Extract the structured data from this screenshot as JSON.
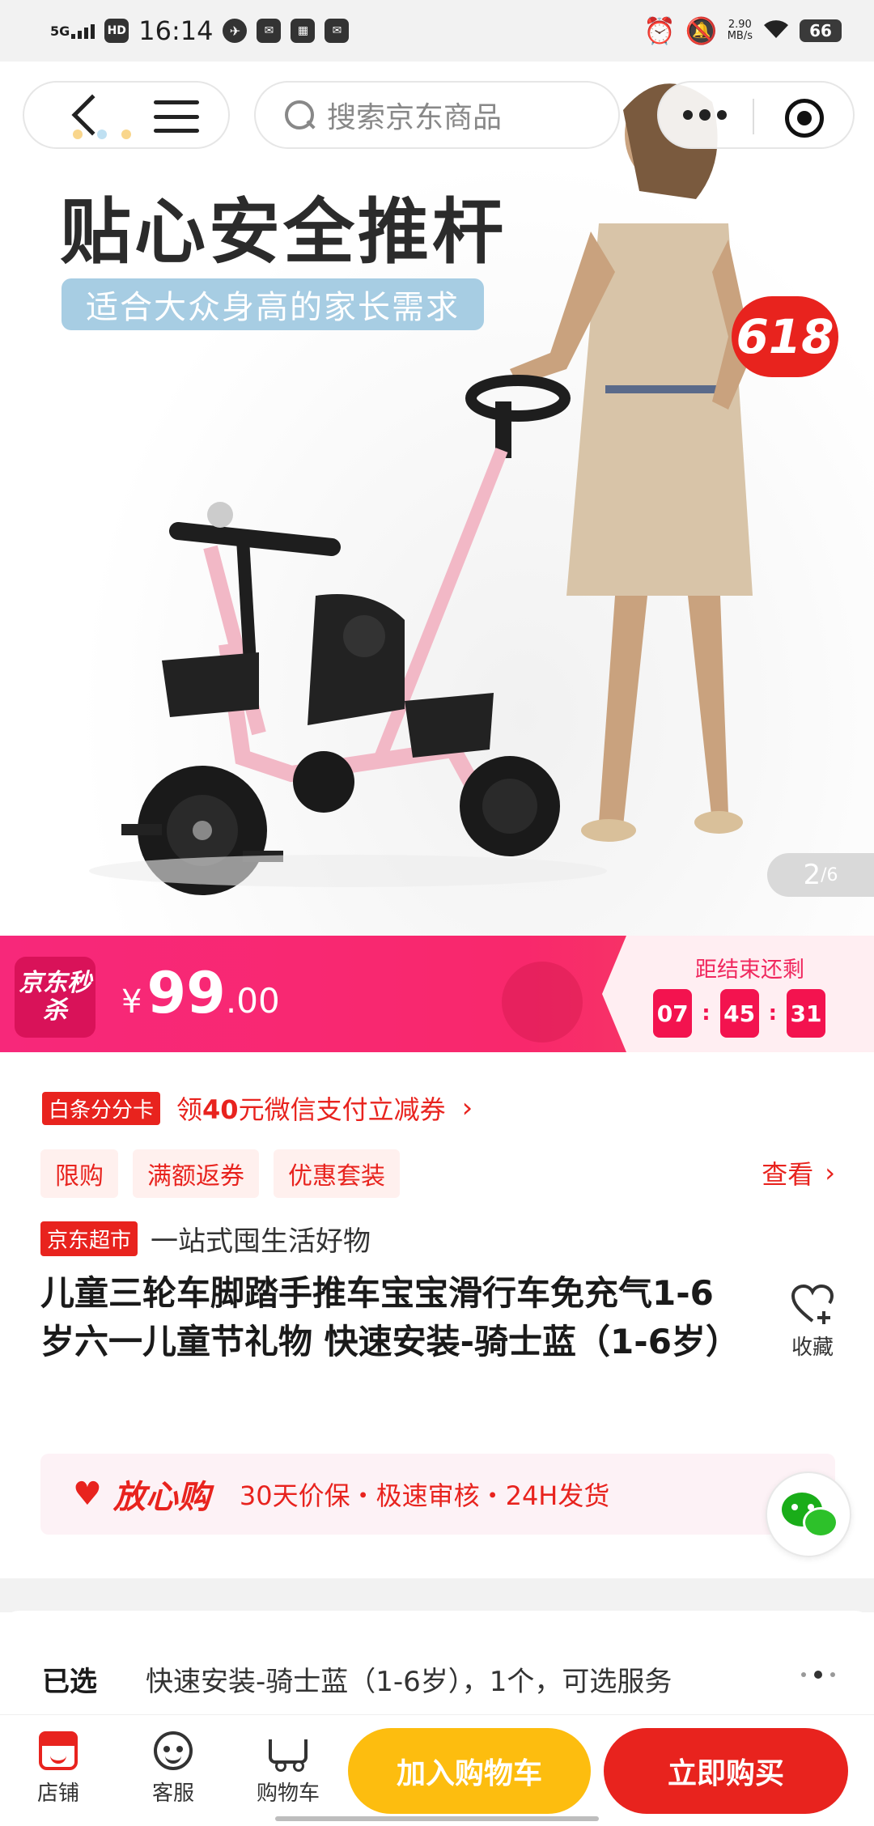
{
  "status_bar": {
    "network": "5G",
    "hd": "HD",
    "time": "16:14",
    "speed_value": "2.90",
    "speed_unit": "MB/s",
    "battery": "66"
  },
  "nav": {
    "search_placeholder": "搜索京东商品"
  },
  "hero": {
    "title": "贴心安全推杆",
    "subtitle": "适合大众身高的家长需求",
    "badge": "618",
    "image_index": "2",
    "image_total": "/6"
  },
  "flash_sale": {
    "logo": "京东秒杀",
    "currency": "¥",
    "price_int": "99",
    "price_dec": ".00",
    "countdown_label": "距结束还剩",
    "hours": "07",
    "minutes": "45",
    "seconds": "31",
    "sep": ":"
  },
  "promo": {
    "tag": "白条分分卡",
    "text_prefix": "领",
    "amount": "40",
    "text_suffix": "元微信支付立减券",
    "chevron": "›"
  },
  "chips": [
    "限购",
    "满额返券",
    "优惠套装"
  ],
  "view_more": "查看",
  "market": {
    "tag": "京东超市",
    "slogan": "一站式囤生活好物"
  },
  "product": {
    "title": "儿童三轮车脚踏手推车宝宝滑行车免充气1-6岁六一儿童节礼物 快速安装-骑士蓝（1-6岁）"
  },
  "favorite": {
    "label": "收藏"
  },
  "assurance": {
    "brand": "放心购",
    "text": "30天价保・极速审核・24H发货"
  },
  "selected": {
    "label": "已选",
    "value": "快速安装-骑士蓝（1-6岁），1个，可选服务"
  },
  "bottom_bar": {
    "store": "店铺",
    "service": "客服",
    "cart": "购物车",
    "add_to_cart": "加入购物车",
    "buy_now": "立即购买"
  },
  "colors": {
    "jd_red": "#e8231e",
    "flash_pink": "#f7287a",
    "cart_yellow": "#fdbd0f"
  }
}
